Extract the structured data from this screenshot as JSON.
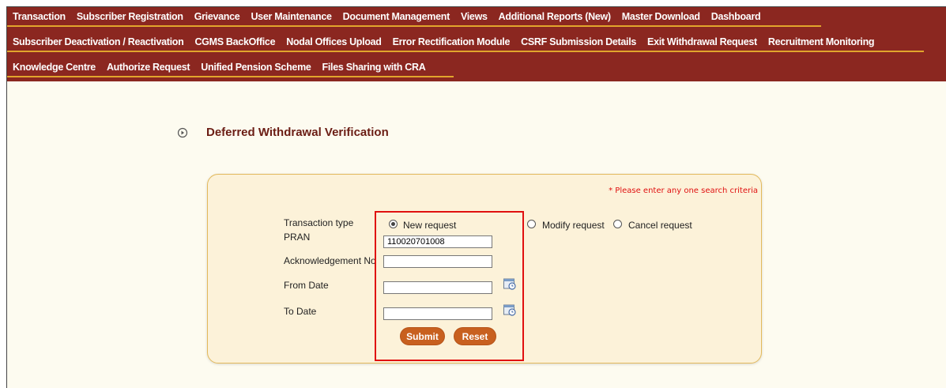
{
  "menu": {
    "row1": [
      "Transaction",
      "Subscriber Registration",
      "Grievance",
      "User Maintenance",
      "Document Management",
      "Views",
      "Additional Reports (New)",
      "Master Download",
      "Dashboard"
    ],
    "row2": [
      "Subscriber Deactivation / Reactivation",
      "CGMS BackOffice",
      "Nodal Offices Upload",
      "Error Rectification Module",
      "CSRF Submission Details",
      "Exit Withdrawal Request",
      "Recruitment Monitoring"
    ],
    "row3": [
      "Knowledge Centre",
      "Authorize Request",
      "Unified Pension Scheme",
      "Files Sharing with CRA"
    ]
  },
  "page": {
    "title": "Deferred Withdrawal Verification"
  },
  "form": {
    "required_note": "* Please enter any one search criteria",
    "transaction_type_label": "Transaction type",
    "options": [
      {
        "label": "New request",
        "selected": true
      },
      {
        "label": "Modify request",
        "selected": false
      },
      {
        "label": "Cancel request",
        "selected": false
      }
    ],
    "pran_label": "PRAN",
    "pran_value": "110020701008",
    "ack_label": "Acknowledgement No",
    "ack_value": "",
    "from_label": "From Date",
    "from_value": "",
    "to_label": "To Date",
    "to_value": "",
    "submit_label": "Submit",
    "reset_label": "Reset"
  },
  "icons": {
    "bullet": "circle-arrow-icon",
    "calendar": "calendar-icon"
  },
  "colors": {
    "menu_bg": "#8b2720",
    "menu_underline": "#e2a52c",
    "panel_bg": "#fcf2d9",
    "button": "#c8601f",
    "highlight": "#e01010"
  }
}
